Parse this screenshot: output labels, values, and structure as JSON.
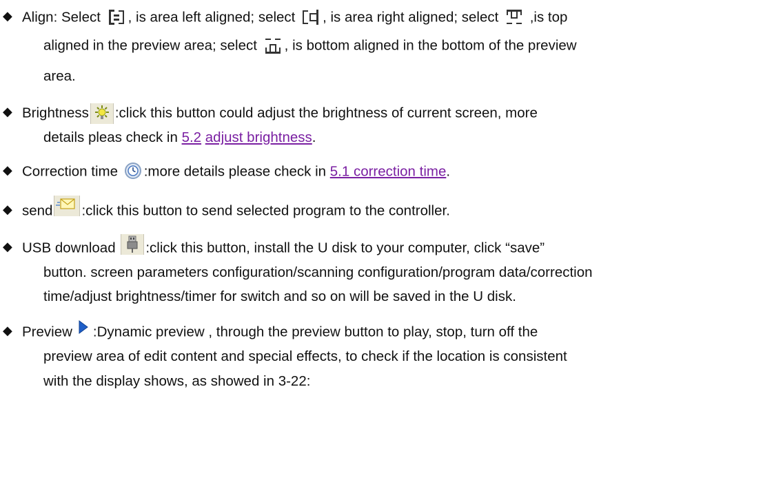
{
  "bullet_glyph": "◆",
  "link_color": "#7a1fa2",
  "items": {
    "align": {
      "l1": "Align: Select ",
      "l2": ", is area left aligned; select ",
      "l3": ", is area right aligned; select ",
      "l4": " ,is top",
      "l5": "aligned in the preview area; select ",
      "l6": ", is bottom aligned in the bottom of the preview",
      "l7": "area.",
      "icons": [
        "align-left-icon",
        "align-right-icon",
        "align-top-icon",
        "align-bottom-icon"
      ]
    },
    "brightness": {
      "l1": "Brightness",
      "l2": ":click this button could adjust the brightness of current screen, more",
      "l3": "details pleas check in ",
      "link1": "5.2",
      "link2": "adjust brightness",
      "l4": ".",
      "icon": "brightness-icon"
    },
    "correction": {
      "l1": "Correction time ",
      "l2": ":more details please check in ",
      "link": "5.1 correction time",
      "l3": ".",
      "icon": "clock-icon"
    },
    "send": {
      "l1": "send",
      "l2": ":click this button to send selected  program to the controller.",
      "icon": "send-mail-icon"
    },
    "usb": {
      "l1": "USB download ",
      "l2": ":click this button, install the U disk to your computer, click “save”",
      "l3": "button. screen parameters configuration/scanning configuration/program data/correction",
      "l4": "time/adjust brightness/timer for switch and so on will be saved  in the U disk.",
      "icon": "usb-icon"
    },
    "preview": {
      "l1": "Preview",
      "l2": ":Dynamic preview , through the preview button to play, stop, turn off the",
      "l3": "preview area of edit content and special effects, to check if the location is consistent",
      "l4": "with the display shows, as showed in 3-22:",
      "icon": "play-icon"
    }
  }
}
